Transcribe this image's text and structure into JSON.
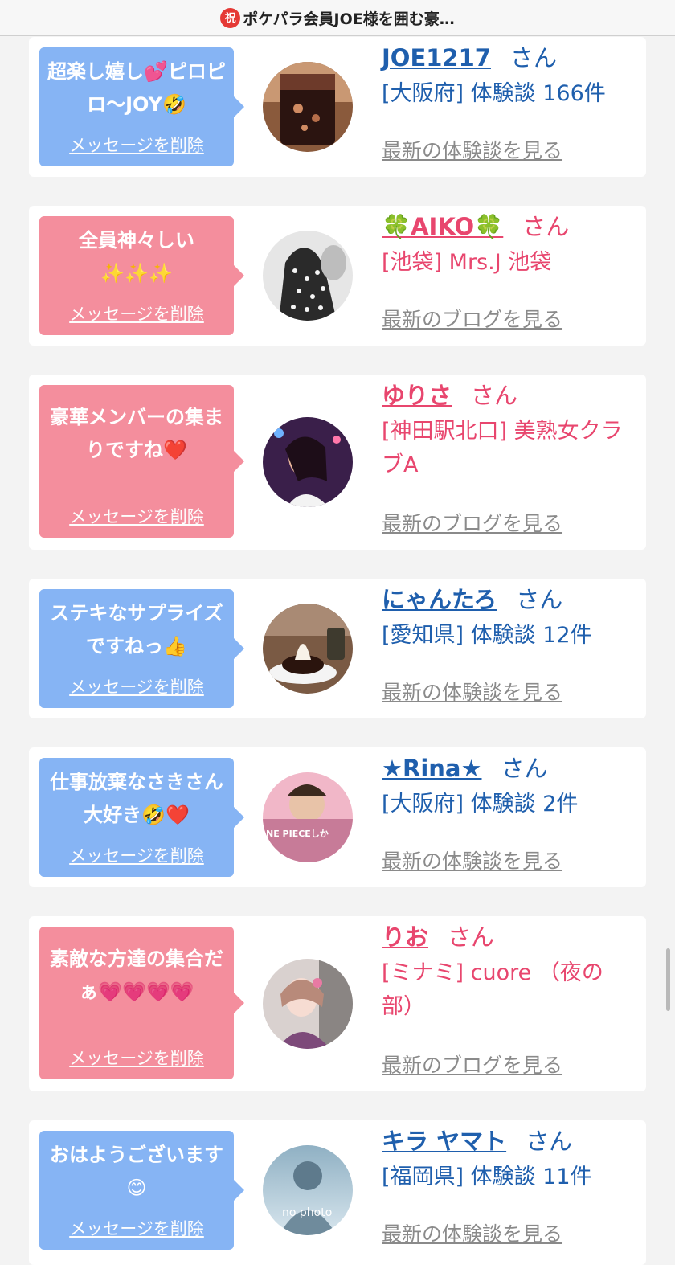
{
  "header": {
    "badge": "祝",
    "title": "ポケパラ会員JOE様を囲む豪…"
  },
  "cards": [
    {
      "message": "超楽し嬉し💕ピロピロ〜JOY🤣",
      "delete_label": "メッセージを削除",
      "name": "JOE1217",
      "san": "さん",
      "shop": "[大阪府] 体験談 166件",
      "link": "最新の体験談を見る",
      "avatar": "drink-glass-photo",
      "colors": {
        "bubble": "#86b4f4",
        "name": "#1f5fad"
      }
    },
    {
      "message": "全員神々しい✨✨✨",
      "delete_label": "メッセージを削除",
      "name": "🍀AIKO🍀",
      "san": "さん",
      "shop": "[池袋] Mrs.J 池袋",
      "link": "最新のブログを見る",
      "avatar": "woman-dotted-dress-photo",
      "colors": {
        "bubble": "#f48e9d",
        "name": "#e8466e"
      }
    },
    {
      "message": "豪華メンバーの集まりですね❤️",
      "delete_label": "メッセージを削除",
      "name": "ゆりさ",
      "san": "さん",
      "shop": "[神田駅北口] 美熟女クラブA",
      "link": "最新のブログを見る",
      "avatar": "woman-portrait-photo",
      "colors": {
        "bubble": "#f48e9d",
        "name": "#e8466e"
      }
    },
    {
      "message": "ステキなサプライズですねっ👍",
      "delete_label": "メッセージを削除",
      "name": "にゃんたろ",
      "san": "さん",
      "shop": "[愛知県] 体験談 12件",
      "link": "最新の体験談を見る",
      "avatar": "dessert-photo",
      "colors": {
        "bubble": "#86b4f4",
        "name": "#1f5fad"
      }
    },
    {
      "message": "仕事放棄なさきさん大好き🤣❤️",
      "delete_label": "メッセージを削除",
      "name": "★Rina★",
      "san": "さん",
      "shop": "[大阪府] 体験談 2件",
      "link": "最新の体験談を見る",
      "avatar": "one-piece-photo",
      "avatar_text": "NE PIECEしか",
      "colors": {
        "bubble": "#86b4f4",
        "name": "#1f5fad"
      }
    },
    {
      "message": "素敵な方達の集合だぁ💗💗💗💗",
      "delete_label": "メッセージを削除",
      "name": "りお",
      "san": "さん",
      "shop": "[ミナミ] cuore （夜の部）",
      "link": "最新のブログを見る",
      "avatar": "woman-kimono-photo",
      "colors": {
        "bubble": "#f48e9d",
        "name": "#e8466e"
      }
    },
    {
      "message": "おはようございます😊",
      "delete_label": "メッセージを削除",
      "name": "キラ ヤマト",
      "san": "さん",
      "shop": "[福岡県] 体験談 11件",
      "link": "最新の体験談を見る",
      "avatar": "no-photo-placeholder",
      "avatar_text": "no photo",
      "colors": {
        "bubble": "#86b4f4",
        "name": "#1f5fad"
      }
    }
  ]
}
